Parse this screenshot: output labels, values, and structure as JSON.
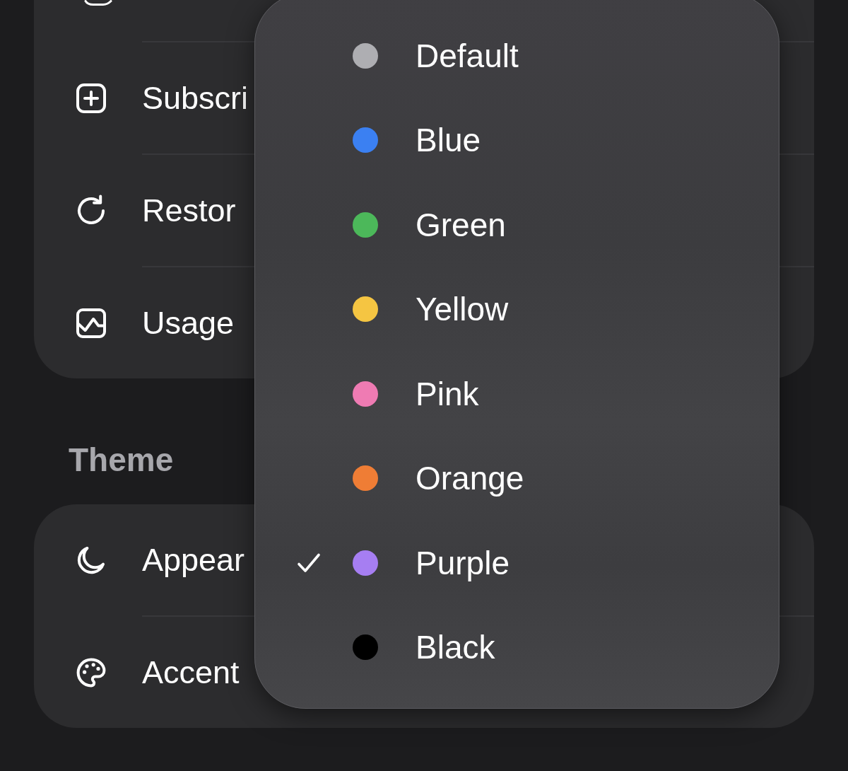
{
  "account_group": {
    "rows": [
      {
        "kind": "cut_off"
      },
      {
        "kind": "item",
        "label": "Subscri"
      },
      {
        "kind": "item",
        "label": "Restor"
      },
      {
        "kind": "item",
        "label": "Usage"
      }
    ]
  },
  "theme_section": {
    "title": "Theme",
    "rows": [
      {
        "kind": "item",
        "label": "Appear"
      },
      {
        "kind": "item",
        "label": "Accent"
      }
    ]
  },
  "accent_menu": {
    "options": [
      {
        "label": "Default",
        "color": "#aeaeb2",
        "selected": false
      },
      {
        "label": "Blue",
        "color": "#3b80f2",
        "selected": false
      },
      {
        "label": "Green",
        "color": "#4cb85a",
        "selected": false
      },
      {
        "label": "Yellow",
        "color": "#f5c542",
        "selected": false
      },
      {
        "label": "Pink",
        "color": "#ef7bb3",
        "selected": false
      },
      {
        "label": "Orange",
        "color": "#ef7d35",
        "selected": false
      },
      {
        "label": "Purple",
        "color": "#a67ef2",
        "selected": true
      },
      {
        "label": "Black",
        "color": "#000000",
        "selected": false
      }
    ]
  }
}
